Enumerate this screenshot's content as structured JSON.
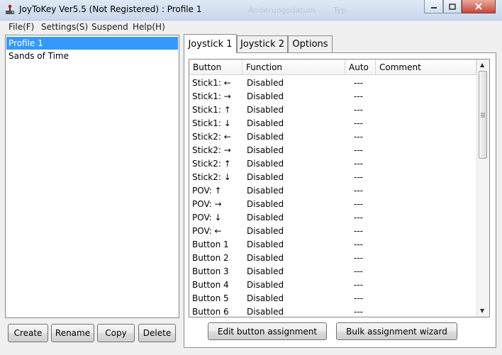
{
  "window": {
    "title": "JoyToKey Ver5.5 (Not Registered) : Profile 1",
    "ghost_left": "Änderungsdatum",
    "ghost_right": "Typ"
  },
  "menu": {
    "items": [
      "File(F)",
      "Settings(S)",
      "Suspend",
      "Help(H)"
    ]
  },
  "profiles": [
    "Profile 1",
    "Sands of Time"
  ],
  "selected_profile": "Profile 1",
  "profile_buttons": {
    "create": "Create",
    "rename": "Rename",
    "copy": "Copy",
    "delete": "Delete"
  },
  "tabs": [
    "Joystick 1",
    "Joystick 2",
    "Options"
  ],
  "active_tab": "Joystick 1",
  "columns": {
    "button": "Button",
    "function": "Function",
    "auto": "Auto",
    "comment": "Comment"
  },
  "rows": [
    {
      "button": "Stick1: ←",
      "function": "Disabled",
      "auto": "---",
      "comment": ""
    },
    {
      "button": "Stick1: →",
      "function": "Disabled",
      "auto": "---",
      "comment": ""
    },
    {
      "button": "Stick1: ↑",
      "function": "Disabled",
      "auto": "---",
      "comment": ""
    },
    {
      "button": "Stick1: ↓",
      "function": "Disabled",
      "auto": "---",
      "comment": ""
    },
    {
      "button": "Stick2: ←",
      "function": "Disabled",
      "auto": "---",
      "comment": ""
    },
    {
      "button": "Stick2: →",
      "function": "Disabled",
      "auto": "---",
      "comment": ""
    },
    {
      "button": "Stick2: ↑",
      "function": "Disabled",
      "auto": "---",
      "comment": ""
    },
    {
      "button": "Stick2: ↓",
      "function": "Disabled",
      "auto": "---",
      "comment": ""
    },
    {
      "button": "POV: ↑",
      "function": "Disabled",
      "auto": "---",
      "comment": ""
    },
    {
      "button": "POV: →",
      "function": "Disabled",
      "auto": "---",
      "comment": ""
    },
    {
      "button": "POV: ↓",
      "function": "Disabled",
      "auto": "---",
      "comment": ""
    },
    {
      "button": "POV: ←",
      "function": "Disabled",
      "auto": "---",
      "comment": ""
    },
    {
      "button": "Button 1",
      "function": "Disabled",
      "auto": "---",
      "comment": ""
    },
    {
      "button": "Button 2",
      "function": "Disabled",
      "auto": "---",
      "comment": ""
    },
    {
      "button": "Button 3",
      "function": "Disabled",
      "auto": "---",
      "comment": ""
    },
    {
      "button": "Button 4",
      "function": "Disabled",
      "auto": "---",
      "comment": ""
    },
    {
      "button": "Button 5",
      "function": "Disabled",
      "auto": "---",
      "comment": ""
    },
    {
      "button": "Button 6",
      "function": "Disabled",
      "auto": "---",
      "comment": ""
    }
  ],
  "actions": {
    "edit": "Edit button assignment",
    "bulk": "Bulk assignment wizard"
  },
  "icons": {
    "app": "joystick-icon",
    "minimize": "minimize-icon",
    "maximize": "maximize-icon",
    "close": "close-icon"
  },
  "colors": {
    "selection": "#3399ff",
    "close_button": "#c7473a"
  }
}
